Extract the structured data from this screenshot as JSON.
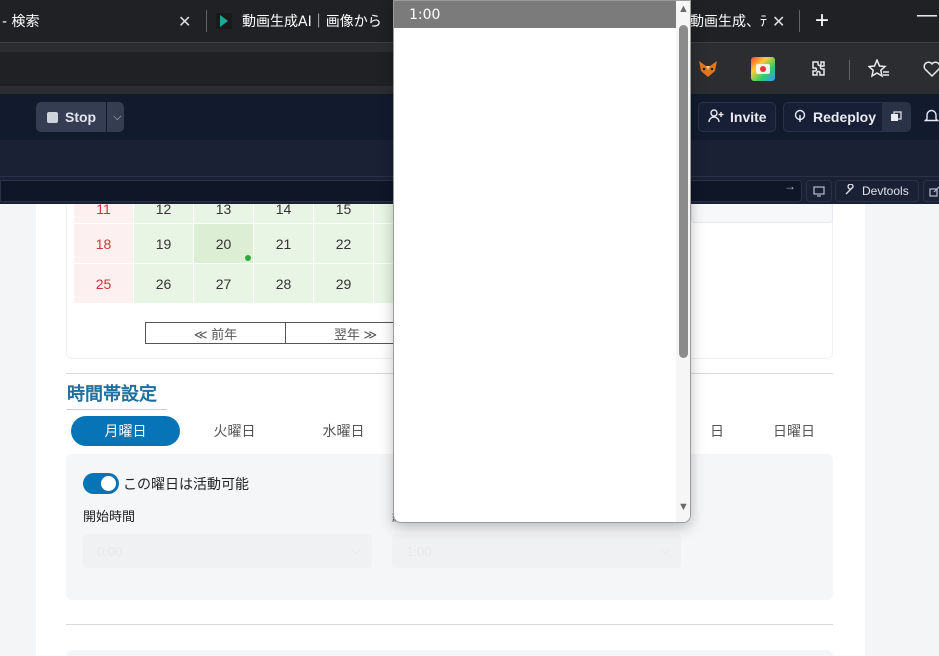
{
  "browser": {
    "tabs": [
      {
        "title": "- 検索",
        "close": "✕"
      },
      {
        "title": "動画生成AI｜画像から",
        "close": ""
      },
      {
        "title": "動画生成、ﾃ",
        "close": "✕"
      }
    ],
    "new_tab_label": "+",
    "minimize_label": "—",
    "extensions": [
      "fox-extension-icon",
      "colorful-extension-icon",
      "puzzle-icon",
      "star-list-icon",
      "heart-pulse-icon"
    ]
  },
  "app_header": {
    "stop_label": "Stop",
    "invite_label": "Invite",
    "redeploy_label": "Redeploy"
  },
  "devbar": {
    "devtools_label": "Devtools",
    "go_arrow": "→"
  },
  "calendar": {
    "rows": [
      [
        "11",
        "12",
        "13",
        "14",
        "15"
      ],
      [
        "18",
        "19",
        "20",
        "21",
        "22"
      ],
      [
        "25",
        "26",
        "27",
        "28",
        "29"
      ]
    ],
    "today": "20",
    "prev_year_label": "≪ 前年",
    "next_year_label": "翌年 ≫"
  },
  "schedule": {
    "section_title": "時間帯設定",
    "day_tabs": [
      "月曜日",
      "火曜日",
      "水曜日",
      "日",
      "日曜日"
    ],
    "active_day": "月曜日",
    "toggle_label": "この曜日は活動可能",
    "toggle_on": true,
    "start_label": "開始時間",
    "end_label": "終",
    "start_value": "0:00",
    "end_value": "1:00"
  },
  "dropdown": {
    "selected_option": "1:00"
  },
  "colors": {
    "accent": "#0874b8",
    "title": "#1f6f9f",
    "sunday": "#c83a3a",
    "available": "#e8f5e4",
    "today_dot": "#2ea83a"
  }
}
